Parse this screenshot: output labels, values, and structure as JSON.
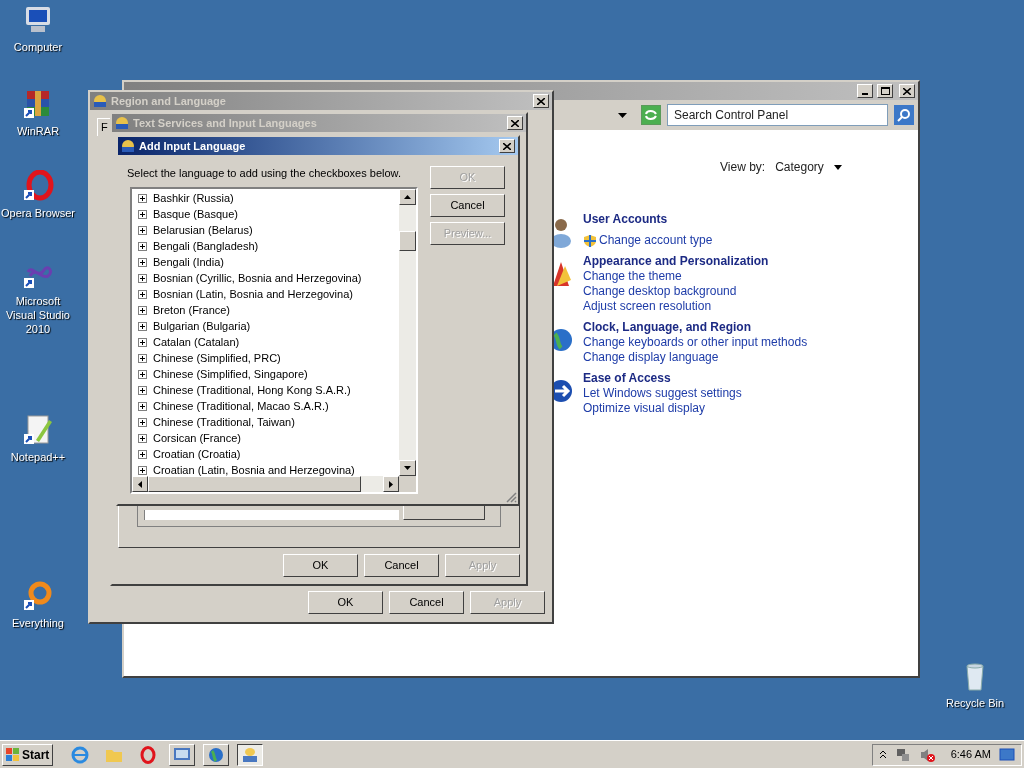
{
  "desktop_icons": [
    {
      "kind": "computer",
      "label": "Computer"
    },
    {
      "kind": "archive",
      "label": "WinRAR"
    },
    {
      "kind": "browser",
      "label": "Opera Browser"
    },
    {
      "kind": "studio",
      "label": "Microsoft Visual Studio 2010"
    },
    {
      "kind": "notepad",
      "label": "Notepad++"
    },
    {
      "kind": "search",
      "label": "Everything"
    },
    {
      "kind": "recycle",
      "label": "Recycle Bin"
    }
  ],
  "control_panel": {
    "active": false,
    "search": {
      "placeholder": "Search Control Panel"
    },
    "view_by": {
      "label": "View by:",
      "value": "Category"
    },
    "categories": [
      {
        "title": "User Accounts",
        "links": [
          "Change account type"
        ]
      },
      {
        "title": "Appearance and Personalization",
        "links": [
          "Change the theme",
          "Change desktop background",
          "Adjust screen resolution"
        ]
      },
      {
        "title": "Clock, Language, and Region",
        "links": [
          "Change keyboards or other input methods",
          "Change display language"
        ]
      },
      {
        "title": "Ease of Access",
        "links": [
          "Let Windows suggest settings",
          "Optimize visual display"
        ]
      }
    ]
  },
  "region_window": {
    "title": "Region and Language",
    "active": false,
    "tab": "F",
    "buttons": [
      {
        "label": "OK",
        "disabled": false
      },
      {
        "label": "Cancel",
        "disabled": false
      },
      {
        "label": "Apply",
        "disabled": true
      }
    ]
  },
  "text_services": {
    "title": "Text Services and Input Languages",
    "active": false,
    "buttons": [
      {
        "label": "OK",
        "disabled": false
      },
      {
        "label": "Cancel",
        "disabled": false
      },
      {
        "label": "Apply",
        "disabled": true
      }
    ]
  },
  "add_language": {
    "title": "Add Input Language",
    "active": true,
    "instruction": "Select the language to add using the checkboxes below.",
    "languages": [
      "Bashkir (Russia)",
      "Basque (Basque)",
      "Belarusian (Belarus)",
      "Bengali (Bangladesh)",
      "Bengali (India)",
      "Bosnian (Cyrillic, Bosnia and Herzegovina)",
      "Bosnian (Latin, Bosnia and Herzegovina)",
      "Breton (France)",
      "Bulgarian (Bulgaria)",
      "Catalan (Catalan)",
      "Chinese (Simplified, PRC)",
      "Chinese (Simplified, Singapore)",
      "Chinese (Traditional, Hong Kong S.A.R.)",
      "Chinese (Traditional, Macao S.A.R.)",
      "Chinese (Traditional, Taiwan)",
      "Corsican (France)",
      "Croatian (Croatia)",
      "Croatian (Latin, Bosnia and Herzegovina)"
    ],
    "buttons": [
      {
        "label": "OK",
        "disabled": true
      },
      {
        "label": "Cancel",
        "disabled": false
      },
      {
        "label": "Preview...",
        "disabled": true
      }
    ]
  },
  "taskbar": {
    "start": "Start",
    "clock": "6:46 AM"
  }
}
